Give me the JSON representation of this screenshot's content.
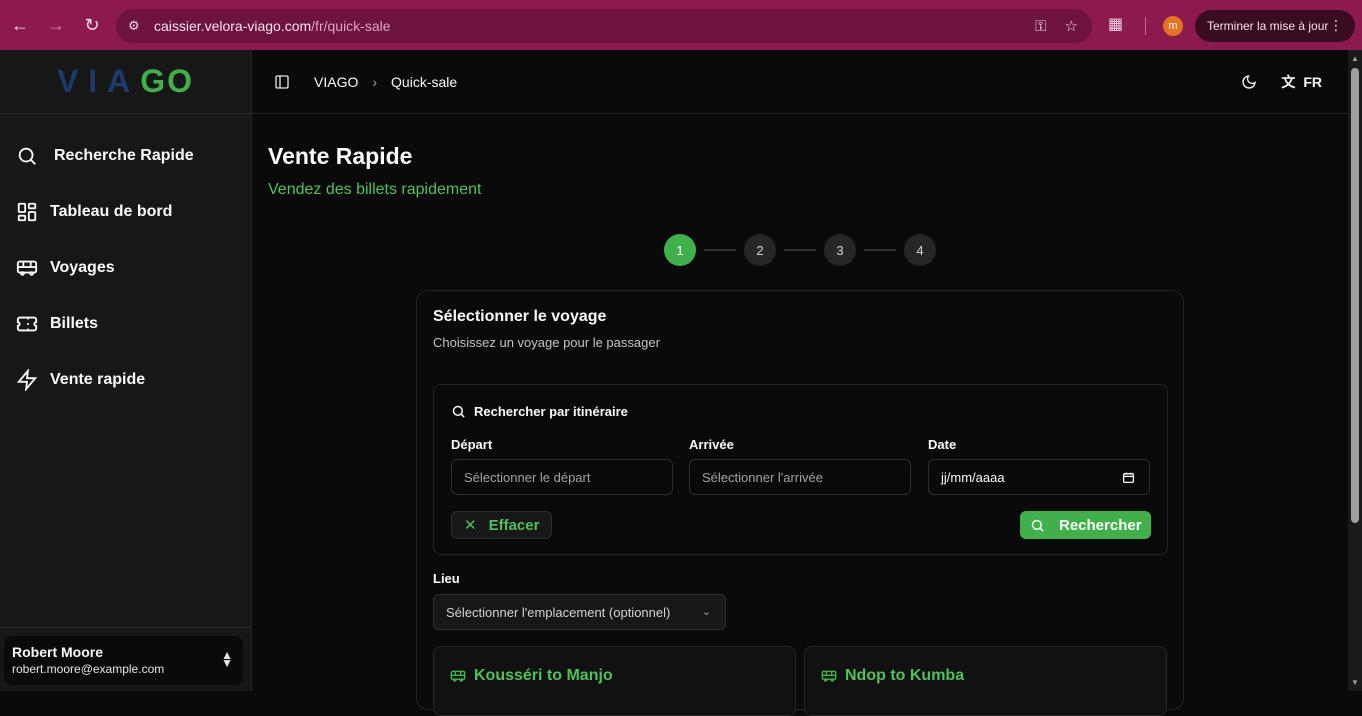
{
  "browser": {
    "url_host": "caissier.velora-viago.com",
    "url_path": "/fr/quick-sale",
    "avatar_letter": "m",
    "update_label": "Terminer la mise à jour"
  },
  "sidebar": {
    "logo_left": "VIA",
    "logo_right": "GO",
    "items": [
      {
        "label": "Recherche Rapide",
        "icon": "search-icon"
      },
      {
        "label": "Tableau de bord",
        "icon": "dashboard-icon"
      },
      {
        "label": "Voyages",
        "icon": "bus-icon"
      },
      {
        "label": "Billets",
        "icon": "ticket-icon"
      },
      {
        "label": "Vente rapide",
        "icon": "lightning-icon"
      }
    ],
    "user": {
      "name": "Robert Moore",
      "email": "robert.moore@example.com"
    }
  },
  "header": {
    "breadcrumb": [
      "VIAGO",
      "Quick-sale"
    ],
    "language": "FR"
  },
  "main": {
    "title": "Vente Rapide",
    "subtitle": "Vendez des billets rapidement",
    "steps": [
      "1",
      "2",
      "3",
      "4"
    ],
    "active_step": 1,
    "card": {
      "title": "Sélectionner le voyage",
      "description": "Choisissez un voyage pour le passager",
      "search": {
        "heading": "Rechercher par itinéraire",
        "departure_label": "Départ",
        "departure_placeholder": "Sélectionner le départ",
        "arrival_label": "Arrivée",
        "arrival_placeholder": "Sélectionner l'arrivée",
        "date_label": "Date",
        "date_value": "jj/mm/aaaa",
        "clear_label": "Effacer",
        "search_label": "Rechercher"
      },
      "location": {
        "label": "Lieu",
        "placeholder": "Sélectionner l'emplacement (optionnel)"
      },
      "trips": [
        "Kousséri to Manjo",
        "Ndop to Kumba"
      ]
    }
  },
  "colors": {
    "accent": "#3fb04a",
    "chrome": "#8d1a4f",
    "logo_blue": "#1c3b6b"
  }
}
